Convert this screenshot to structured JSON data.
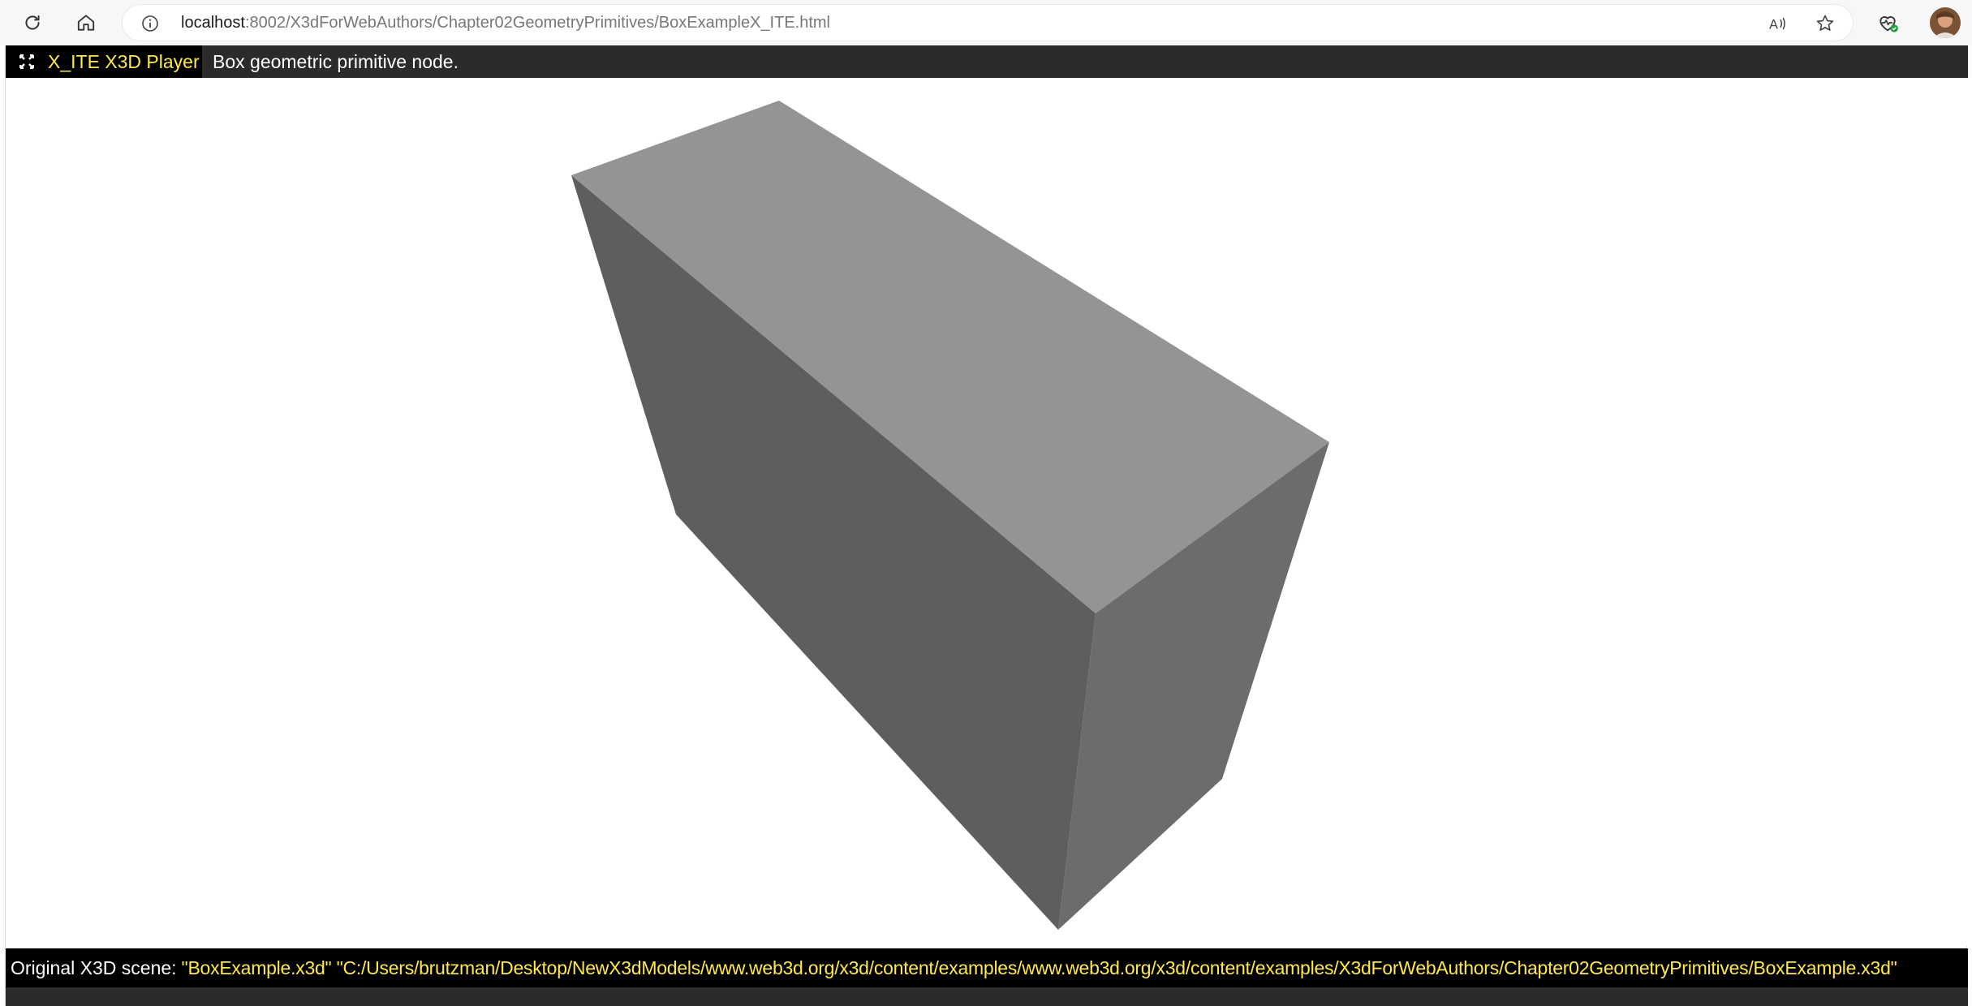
{
  "browser": {
    "url_host": "localhost",
    "url_path": ":8002/X3dForWebAuthors/Chapter02GeometryPrimitives/BoxExampleX_ITE.html",
    "icons": {
      "refresh": "refresh-icon",
      "home": "home-icon",
      "info": "info-icon",
      "read_aloud": "read-aloud-icon",
      "favorite": "star-icon",
      "health": "browser-essentials-icon",
      "profile": "avatar"
    }
  },
  "player": {
    "title": "X_ITE X3D Player",
    "scene_title": "Box geometric primitive node.",
    "fullscreen_icon": "fullscreen-icon",
    "colors": {
      "accent": "#ffe84a",
      "header_bg": "#2b2b2b",
      "tab_bg": "#000000",
      "box_top": "#949494",
      "box_front": "#5e5e5e",
      "box_side": "#6c6c6c"
    }
  },
  "footer": {
    "label": "Original X3D scene:",
    "value": "\"BoxExample.x3d\" \"C:/Users/brutzman/Desktop/NewX3dModels/www.web3d.org/x3d/content/examples/www.web3d.org/x3d/content/examples/X3dForWebAuthors/Chapter02GeometryPrimitives/BoxExample.x3d\""
  }
}
